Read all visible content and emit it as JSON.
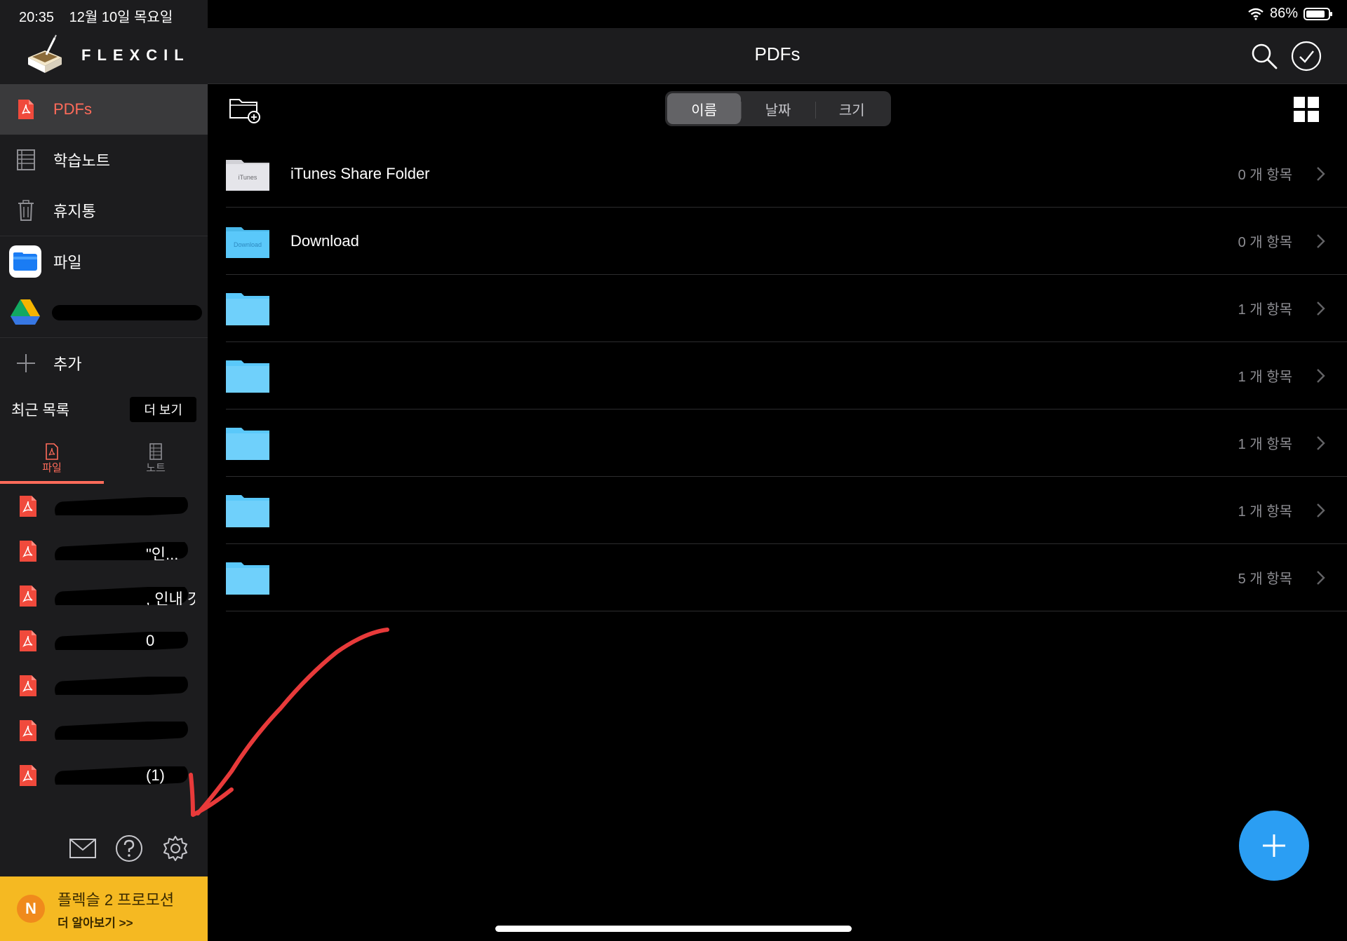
{
  "status": {
    "time": "20:35",
    "date": "12월 10일 목요일",
    "battery": "86%",
    "battery_level": 0.86
  },
  "brand": {
    "name": "FLEXCIL"
  },
  "sidebar": {
    "nav": [
      {
        "label": "PDFs",
        "icon": "pdf-icon",
        "active": true
      },
      {
        "label": "학습노트",
        "icon": "notebook-icon"
      },
      {
        "label": "휴지통",
        "icon": "trash-icon"
      }
    ],
    "storage": [
      {
        "label": "파일",
        "icon": "files-app-icon"
      },
      {
        "label": "",
        "icon": "google-drive-icon"
      },
      {
        "label": "추가",
        "icon": "plus-icon"
      }
    ],
    "recent": {
      "title": "최근 목록",
      "more": "더 보기",
      "tabs": [
        {
          "label": "파일",
          "icon": "pdf-outline-icon",
          "active": true
        },
        {
          "label": "노트",
          "icon": "note-outline-icon"
        }
      ],
      "items": [
        {
          "name": ""
        },
        {
          "name": "\"인..."
        },
        {
          "name": ", 인내 것..."
        },
        {
          "name": "0"
        },
        {
          "name": ""
        },
        {
          "name": ""
        },
        {
          "name": "(1)"
        }
      ]
    },
    "footer_icons": [
      "mail-icon",
      "help-icon",
      "settings-icon"
    ],
    "promo": {
      "badge": "N",
      "title": "플렉슬 2 프로모션",
      "subtitle": "더 알아보기 >>"
    }
  },
  "header": {
    "title": "PDFs"
  },
  "sort": {
    "options": [
      "이름",
      "날짜",
      "크기"
    ],
    "selected": "이름"
  },
  "folders": [
    {
      "name": "iTunes Share Folder",
      "count": "0 개 항목",
      "type": "itunes",
      "icon_caption": "iTunes"
    },
    {
      "name": "Download",
      "count": "0 개 항목",
      "type": "download",
      "icon_caption": "Download"
    },
    {
      "name": "",
      "count": "1 개 항목",
      "type": "plain"
    },
    {
      "name": "",
      "count": "1 개 항목",
      "type": "plain"
    },
    {
      "name": "",
      "count": "1 개 항목",
      "type": "plain"
    },
    {
      "name": "",
      "count": "1 개 항목",
      "type": "plain"
    },
    {
      "name": "",
      "count": "5 개 항목",
      "type": "plain"
    }
  ],
  "colors": {
    "accent": "#ff6b5a",
    "fab": "#2b9ef3",
    "promo": "#f5b922",
    "folder": "#5ac8fa",
    "annotation": "#e83a3a"
  }
}
